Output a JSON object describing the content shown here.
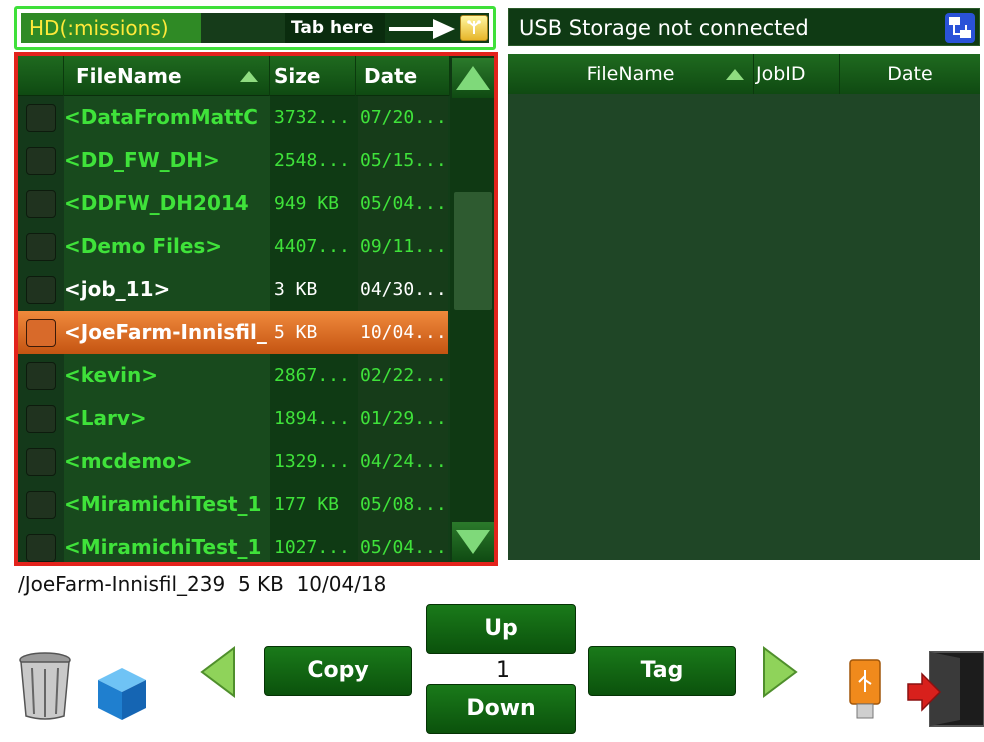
{
  "hd_bar": {
    "label": "HD(:missions)",
    "tab_hint": "Tab here"
  },
  "usb_bar": {
    "label": "USB Storage not connected"
  },
  "left_list": {
    "headers": {
      "filename": "FileName",
      "size": "Size",
      "date": "Date"
    },
    "rows": [
      {
        "name": "<DataFromMattC",
        "size": "3732...",
        "date": "07/20...",
        "color": "#3fe23a",
        "selected": false
      },
      {
        "name": "<DD_FW_DH>",
        "size": "2548...",
        "date": "05/15...",
        "color": "#3fe23a",
        "selected": false
      },
      {
        "name": "<DDFW_DH2014",
        "size": "949 KB",
        "date": "05/04...",
        "color": "#3fe23a",
        "selected": false
      },
      {
        "name": "<Demo Files>",
        "size": "4407...",
        "date": "09/11...",
        "color": "#3fe23a",
        "selected": false
      },
      {
        "name": "<job_11>",
        "size": "3 KB",
        "date": "04/30...",
        "color": "#ffffff",
        "selected": false
      },
      {
        "name": "<JoeFarm-Innisfil_",
        "size": "5 KB",
        "date": "10/04...",
        "color": "#ffffff",
        "selected": true
      },
      {
        "name": "<kevin>",
        "size": "2867...",
        "date": "02/22...",
        "color": "#3fe23a",
        "selected": false
      },
      {
        "name": "<Larv>",
        "size": "1894...",
        "date": "01/29...",
        "color": "#3fe23a",
        "selected": false
      },
      {
        "name": "<mcdemo>",
        "size": "1329...",
        "date": "04/24...",
        "color": "#3fe23a",
        "selected": false
      },
      {
        "name": "<MiramichiTest_1",
        "size": "177 KB",
        "date": "05/08...",
        "color": "#3fe23a",
        "selected": false
      },
      {
        "name": "<MiramichiTest_1",
        "size": "1027...",
        "date": "05/04...",
        "color": "#3fe23a",
        "selected": false
      }
    ]
  },
  "right_list": {
    "headers": {
      "filename": "FileName",
      "jobid": "JobID",
      "date": "Date"
    }
  },
  "status_line": "/JoeFarm-Innisfil_239  5 KB  10/04/18",
  "toolbar": {
    "copy_label": "Copy",
    "up_label": "Up",
    "down_label": "Down",
    "page_number": "1",
    "tag_label": "Tag"
  },
  "icons": {
    "trash": "trash-icon",
    "cube": "cube-icon",
    "prev": "left-arrow-icon",
    "next": "right-arrow-icon",
    "usb": "usb-drive-icon",
    "exit": "exit-door-icon"
  },
  "colors": {
    "selection": "#e0702a",
    "panel_border": "#e3231c",
    "hd_border": "#3fe03a",
    "list_text": "#3fe23a"
  }
}
